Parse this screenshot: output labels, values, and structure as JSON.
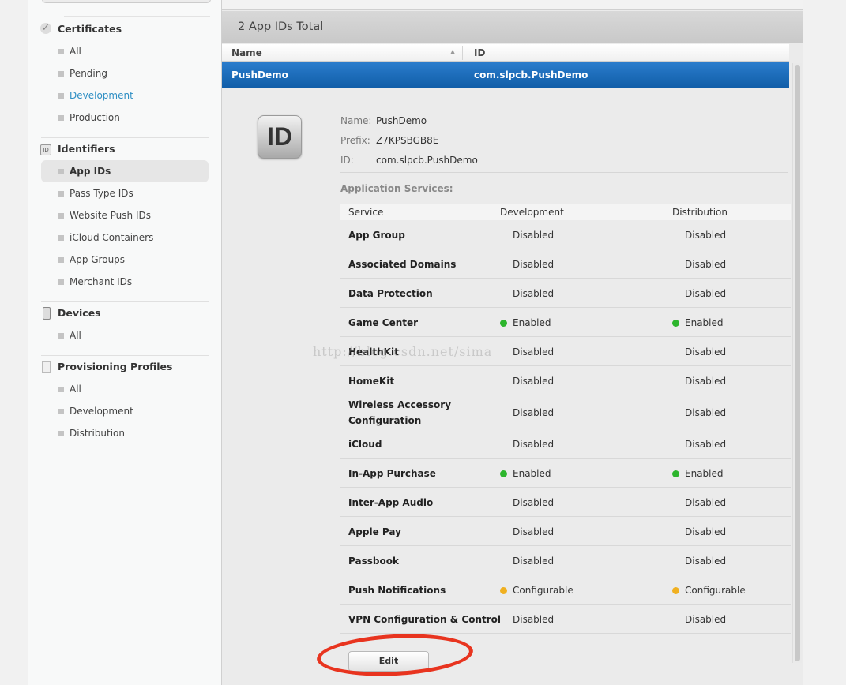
{
  "sidebar": {
    "sections": [
      {
        "title": "Certificates",
        "icon": "certificate-icon",
        "items": [
          "All",
          "Pending",
          "Development",
          "Production"
        ]
      },
      {
        "title": "Identifiers",
        "icon": "id-icon",
        "items": [
          "App IDs",
          "Pass Type IDs",
          "Website Push IDs",
          "iCloud Containers",
          "App Groups",
          "Merchant IDs"
        ]
      },
      {
        "title": "Devices",
        "icon": "device-icon",
        "items": [
          "All"
        ]
      },
      {
        "title": "Provisioning Profiles",
        "icon": "document-icon",
        "items": [
          "All",
          "Development",
          "Distribution"
        ]
      }
    ],
    "active": "App IDs",
    "hover_link": "Development"
  },
  "main": {
    "total": "2 App IDs Total",
    "columns": {
      "name": "Name",
      "id": "ID"
    },
    "selected": {
      "name": "PushDemo",
      "id": "com.slpcb.PushDemo"
    },
    "detail": {
      "icon_text": "ID",
      "name_label": "Name:",
      "name": "PushDemo",
      "prefix_label": "Prefix:",
      "prefix": "Z7KPSBGB8E",
      "id_label": "ID:",
      "id": "com.slpcb.PushDemo",
      "services_title": "Application Services:",
      "headers": [
        "Service",
        "Development",
        "Distribution"
      ],
      "services": [
        {
          "name": "App Group",
          "dev": "Disabled",
          "dist": "Disabled"
        },
        {
          "name": "Associated Domains",
          "dev": "Disabled",
          "dist": "Disabled"
        },
        {
          "name": "Data Protection",
          "dev": "Disabled",
          "dist": "Disabled"
        },
        {
          "name": "Game Center",
          "dev": "Enabled",
          "dist": "Enabled"
        },
        {
          "name": "HealthKit",
          "dev": "Disabled",
          "dist": "Disabled"
        },
        {
          "name": "HomeKit",
          "dev": "Disabled",
          "dist": "Disabled"
        },
        {
          "name": "Wireless Accessory Configuration",
          "dev": "Disabled",
          "dist": "Disabled"
        },
        {
          "name": "iCloud",
          "dev": "Disabled",
          "dist": "Disabled"
        },
        {
          "name": "In-App Purchase",
          "dev": "Enabled",
          "dist": "Enabled"
        },
        {
          "name": "Inter-App Audio",
          "dev": "Disabled",
          "dist": "Disabled"
        },
        {
          "name": "Apple Pay",
          "dev": "Disabled",
          "dist": "Disabled"
        },
        {
          "name": "Passbook",
          "dev": "Disabled",
          "dist": "Disabled"
        },
        {
          "name": "Push Notifications",
          "dev": "Configurable",
          "dist": "Configurable"
        },
        {
          "name": "VPN Configuration & Control",
          "dev": "Disabled",
          "dist": "Disabled"
        }
      ],
      "edit_label": "Edit"
    }
  },
  "status_colors": {
    "Enabled": "#2db52d",
    "Configurable": "#f0b020"
  },
  "watermark": "http://blog.csdn.net/sima"
}
